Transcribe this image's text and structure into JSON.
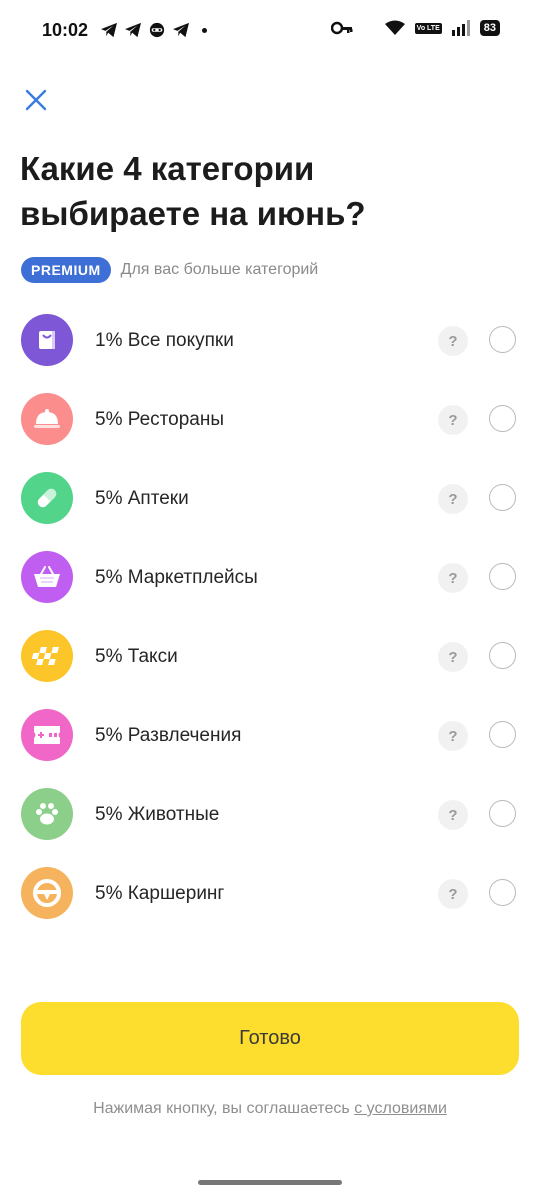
{
  "status_bar": {
    "time": "10:02",
    "battery": "83",
    "volte": "Vo LTE",
    "icons": [
      "telegram-icon",
      "telegram-icon",
      "mask-icon",
      "telegram-icon",
      "dot-icon",
      "key-icon",
      "wifi-icon",
      "volte-icon",
      "signal-icon",
      "battery-icon"
    ]
  },
  "header": {
    "close_icon": "close-icon",
    "title": "Какие 4 категории выбираете на июнь?"
  },
  "premium": {
    "badge": "PREMIUM",
    "text": "Для вас больше категорий"
  },
  "categories": [
    {
      "label": "1% Все покупки",
      "icon": "shopping-bag-icon",
      "color": "#7e57d6"
    },
    {
      "label": "5% Рестораны",
      "icon": "cloche-icon",
      "color": "#fb8d8d"
    },
    {
      "label": "5% Аптеки",
      "icon": "pill-icon",
      "color": "#53d48b"
    },
    {
      "label": "5% Маркетплейсы",
      "icon": "basket-icon",
      "color": "#c15ef2"
    },
    {
      "label": "5% Такси",
      "icon": "taxi-checker-icon",
      "color": "#fcc62a"
    },
    {
      "label": "5% Развлечения",
      "icon": "ticket-icon",
      "color": "#f067c8"
    },
    {
      "label": "5% Животные",
      "icon": "paw-icon",
      "color": "#8ccf8a"
    },
    {
      "label": "5% Каршеринг",
      "icon": "steering-wheel-icon",
      "color": "#f6b35e"
    }
  ],
  "help_label": "?",
  "done_button": "Готово",
  "terms": {
    "prefix": "Нажимая кнопку, вы соглашаетесь ",
    "link": "с условиями"
  },
  "colors": {
    "accent_yellow": "#fddd2d",
    "premium_blue": "#3e6fd6",
    "close_blue": "#3a7be0"
  }
}
